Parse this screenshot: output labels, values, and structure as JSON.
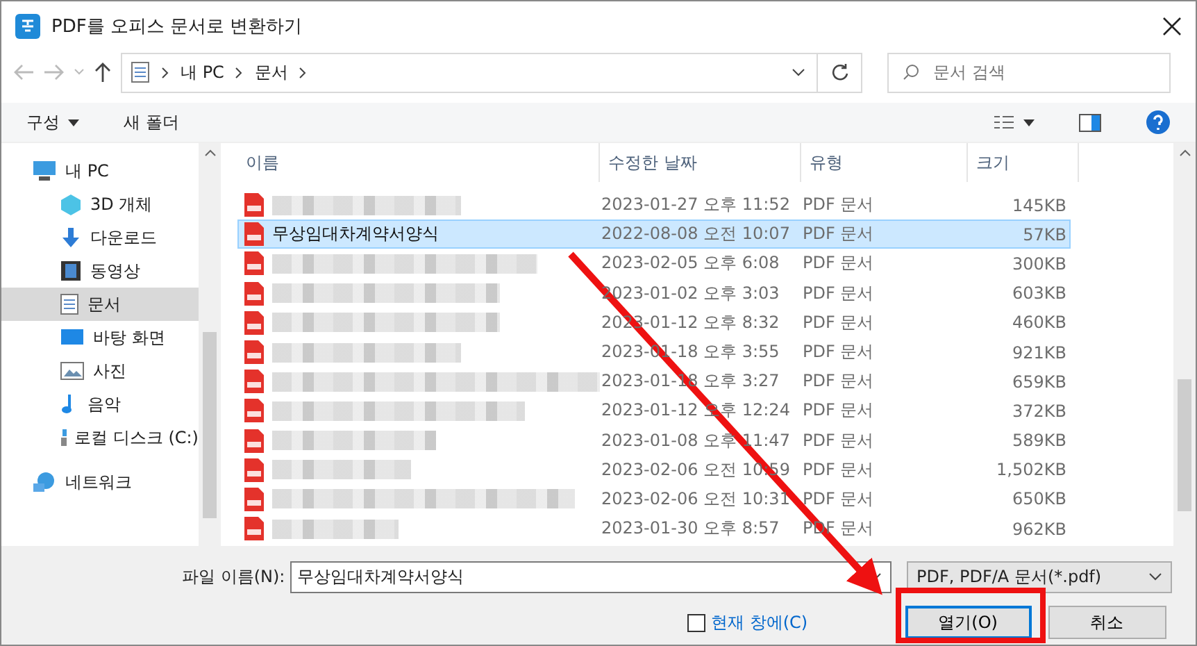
{
  "window": {
    "title": "PDF를 오피스 문서로 변환하기"
  },
  "address": {
    "path": [
      "내 PC",
      "문서"
    ]
  },
  "search": {
    "placeholder": "문서 검색"
  },
  "toolbar": {
    "organize": "구성",
    "new_folder": "새 폴더"
  },
  "sidebar": {
    "items": [
      {
        "label": "내 PC",
        "kind": "pc",
        "selected": false,
        "children": [
          {
            "label": "3D 개체",
            "kind": "cube",
            "selected": false
          },
          {
            "label": "다운로드",
            "kind": "download",
            "selected": false
          },
          {
            "label": "동영상",
            "kind": "video",
            "selected": false
          },
          {
            "label": "문서",
            "kind": "document",
            "selected": true
          },
          {
            "label": "바탕 화면",
            "kind": "desktop",
            "selected": false
          },
          {
            "label": "사진",
            "kind": "picture",
            "selected": false
          },
          {
            "label": "음악",
            "kind": "music",
            "selected": false
          },
          {
            "label": "로컬 디스크 (C:)",
            "kind": "drive",
            "selected": false
          }
        ]
      },
      {
        "label": "네트워크",
        "kind": "network",
        "selected": false
      }
    ]
  },
  "table": {
    "columns": [
      "이름",
      "수정한 날짜",
      "유형",
      "크기"
    ],
    "rows": [
      {
        "modified": "2023-01-27 오후 11:52",
        "type": "PDF 문서",
        "size": "145KB",
        "selected": false
      },
      {
        "name": "무상임대차계약서양식",
        "modified": "2022-08-08 오전 10:07",
        "type": "PDF 문서",
        "size": "57KB",
        "selected": true
      },
      {
        "modified": "2023-02-05 오후 6:08",
        "type": "PDF 문서",
        "size": "300KB",
        "selected": false
      },
      {
        "modified": "2023-01-02 오후 3:03",
        "type": "PDF 문서",
        "size": "603KB",
        "selected": false
      },
      {
        "modified": "2023-01-12 오후 8:32",
        "type": "PDF 문서",
        "size": "460KB",
        "selected": false
      },
      {
        "modified": "2023-01-18 오후 3:55",
        "type": "PDF 문서",
        "size": "921KB",
        "selected": false
      },
      {
        "modified": "2023-01-18 오후 3:27",
        "type": "PDF 문서",
        "size": "659KB",
        "selected": false
      },
      {
        "modified": "2023-01-12 오후 12:24",
        "type": "PDF 문서",
        "size": "372KB",
        "selected": false
      },
      {
        "modified": "2023-01-08 오후 11:47",
        "type": "PDF 문서",
        "size": "589KB",
        "selected": false
      },
      {
        "modified": "2023-02-06 오전 10:59",
        "type": "PDF 문서",
        "size": "1,502KB",
        "selected": false
      },
      {
        "modified": "2023-02-06 오전 10:31",
        "type": "PDF 문서",
        "size": "650KB",
        "selected": false
      },
      {
        "modified": "2023-01-30 오후 8:57",
        "type": "PDF 문서",
        "size": "962KB",
        "selected": false
      }
    ]
  },
  "footer": {
    "file_name_label": "파일 이름(N):",
    "file_name": "무상임대차계약서양식",
    "file_type": "PDF, PDF/A 문서(*.pdf)",
    "checkbox": {
      "label": "현재 창에(C)",
      "checked": false
    },
    "buttons": [
      "열기(O)",
      "취소"
    ]
  }
}
